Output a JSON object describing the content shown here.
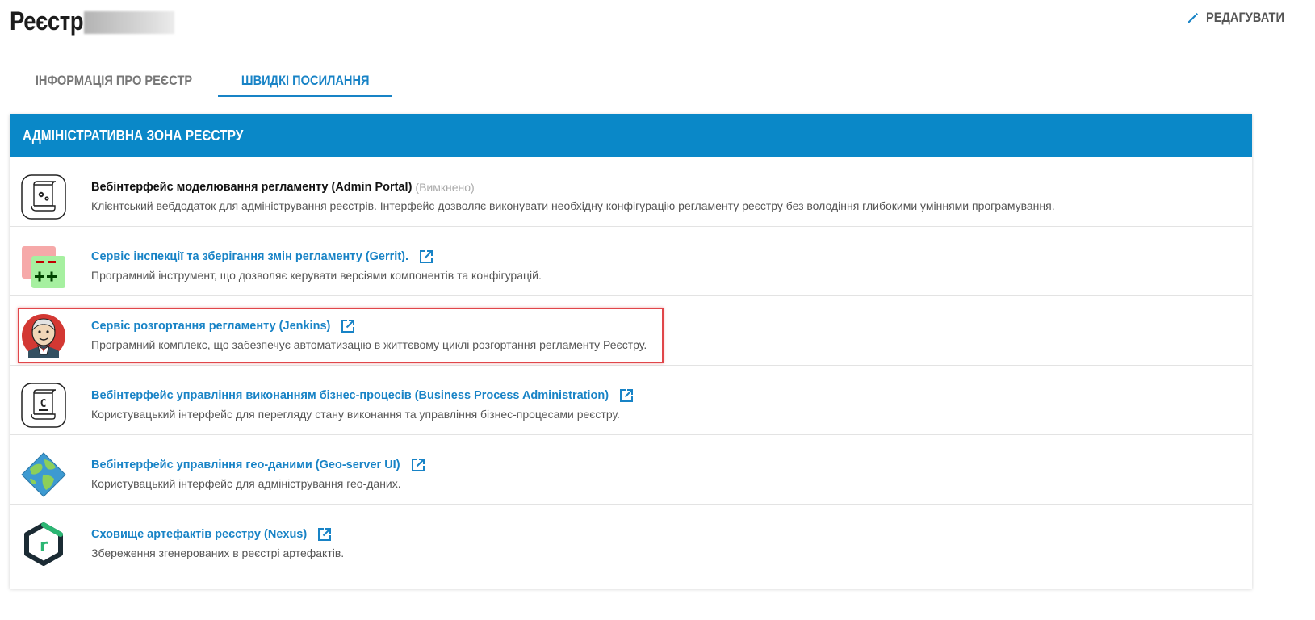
{
  "header": {
    "title": "Реєстр",
    "edit_label": "РЕДАГУВАТИ"
  },
  "tabs": [
    {
      "label": "ІНФОРМАЦІЯ ПРО РЕЄСТР",
      "active": false
    },
    {
      "label": "ШВИДКІ ПОСИЛАННЯ",
      "active": true
    }
  ],
  "panel": {
    "title": "АДМІНІСТРАТИВНА ЗОНА РЕЄСТРУ",
    "items": [
      {
        "title": "Вебінтерфейс моделювання регламенту (Admin Portal)",
        "status": "(Вимкнено)",
        "description": "Клієнтський вебдодаток для адміністрування реєстрів. Інтерфейс дозволяє виконувати необхідну конфігурацію регламенту реєстру без володіння глибокими уміннями програмування.",
        "icon": "admin-portal-scroll-icon"
      },
      {
        "title": "Сервіс інспекції та зберігання змін регламенту (Gerrit).",
        "description": "Програмний інструмент, що дозволяє керувати версіями компонентів та конфігурацій.",
        "icon": "gerrit-diff-icon"
      },
      {
        "title": "Сервіс розгортання регламенту (Jenkins)",
        "description": "Програмний комплекс, що забезпечує автоматизацію в життєвому циклі розгортання регламенту Реєстру.",
        "icon": "jenkins-butler-icon"
      },
      {
        "title": "Вебінтерфейс управління виконанням бізнес-процесів (Business Process Administration)",
        "description": "Користувацький інтерфейс для перегляду стану виконання та управління бізнес-процесами реєстру.",
        "icon": "camunda-scroll-icon"
      },
      {
        "title": "Вебінтерфейс управління гео-даними (Geo-server UI)",
        "description": "Користувацький інтерфейс для адміністрування гео-даних.",
        "icon": "geoserver-globe-icon"
      },
      {
        "title": "Сховище артефактів реєстру (Nexus)",
        "description": "Збереження згенерованих в реєстрі артефактів.",
        "icon": "nexus-hexagon-icon"
      }
    ]
  },
  "colors": {
    "accent": "#1883c6",
    "panel_header": "#0a88c8",
    "highlight": "#e0464a"
  }
}
